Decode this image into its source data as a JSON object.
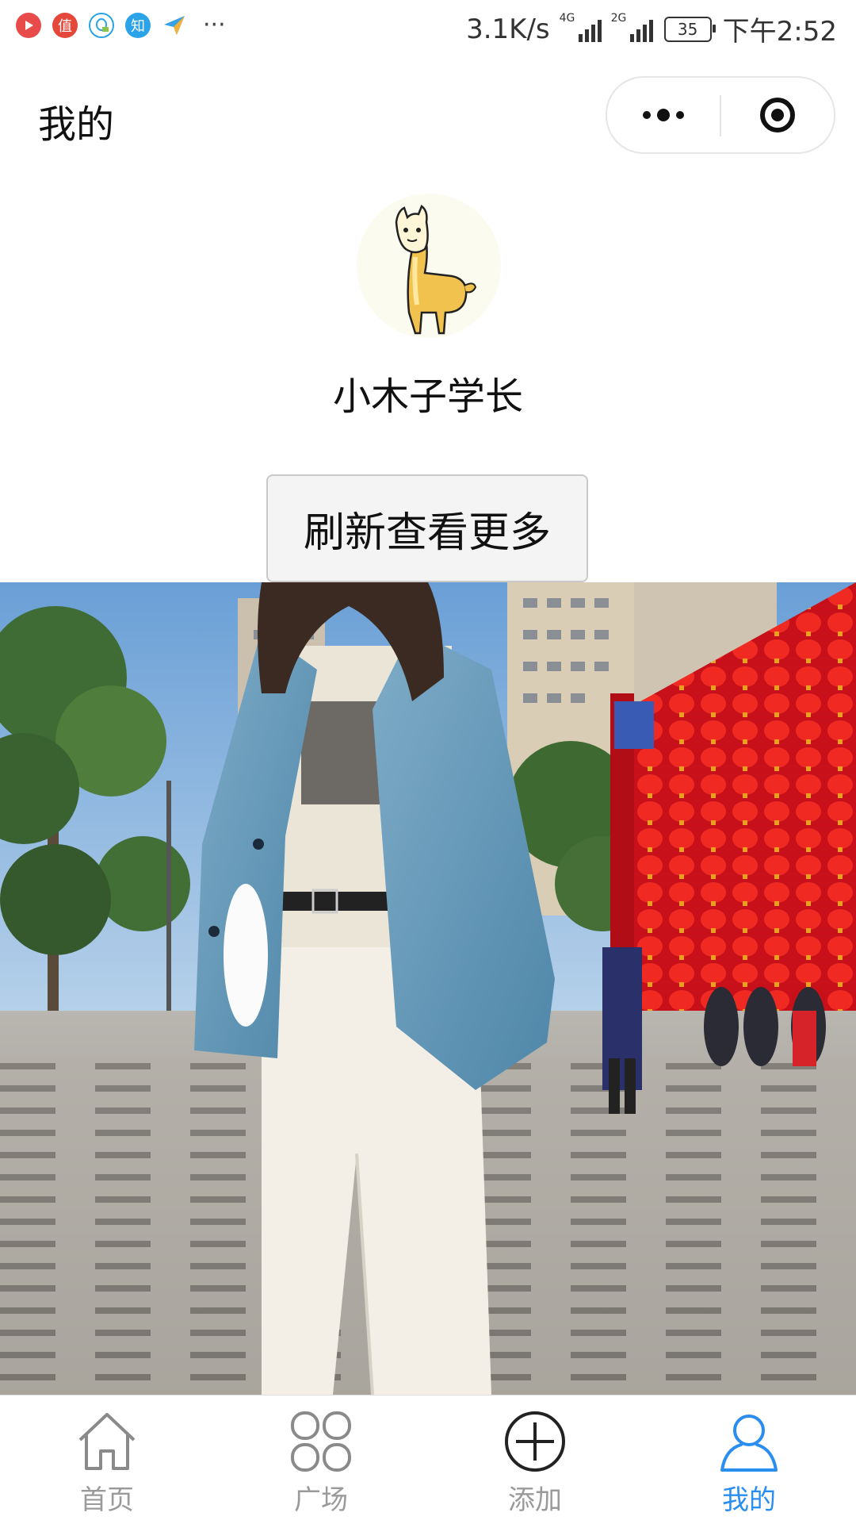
{
  "status_bar": {
    "net_speed": "3.1K/s",
    "sig1_tag": "4G",
    "sig2_tag": "2G",
    "battery": "35",
    "time": "下午2:52",
    "notif_icons": [
      "video-app-icon",
      "zhi-app-icon",
      "qq-icon",
      "zhihu-icon",
      "paper-plane-icon"
    ],
    "zhi_glyph": "值",
    "zhihu_glyph": "知",
    "more": "···"
  },
  "nav": {
    "title": "我的"
  },
  "profile": {
    "name": "小木子学长"
  },
  "refresh_button": {
    "label": "刷新查看更多"
  },
  "tabbar": {
    "accent": "#2a8ef0",
    "inactive_color": "#9a9a9a",
    "items": [
      {
        "label": "首页",
        "icon": "home-icon"
      },
      {
        "label": "广场",
        "icon": "grid-icon"
      },
      {
        "label": "添加",
        "icon": "plus-circle-icon"
      },
      {
        "label": "我的",
        "icon": "user-icon",
        "active": true
      }
    ]
  }
}
